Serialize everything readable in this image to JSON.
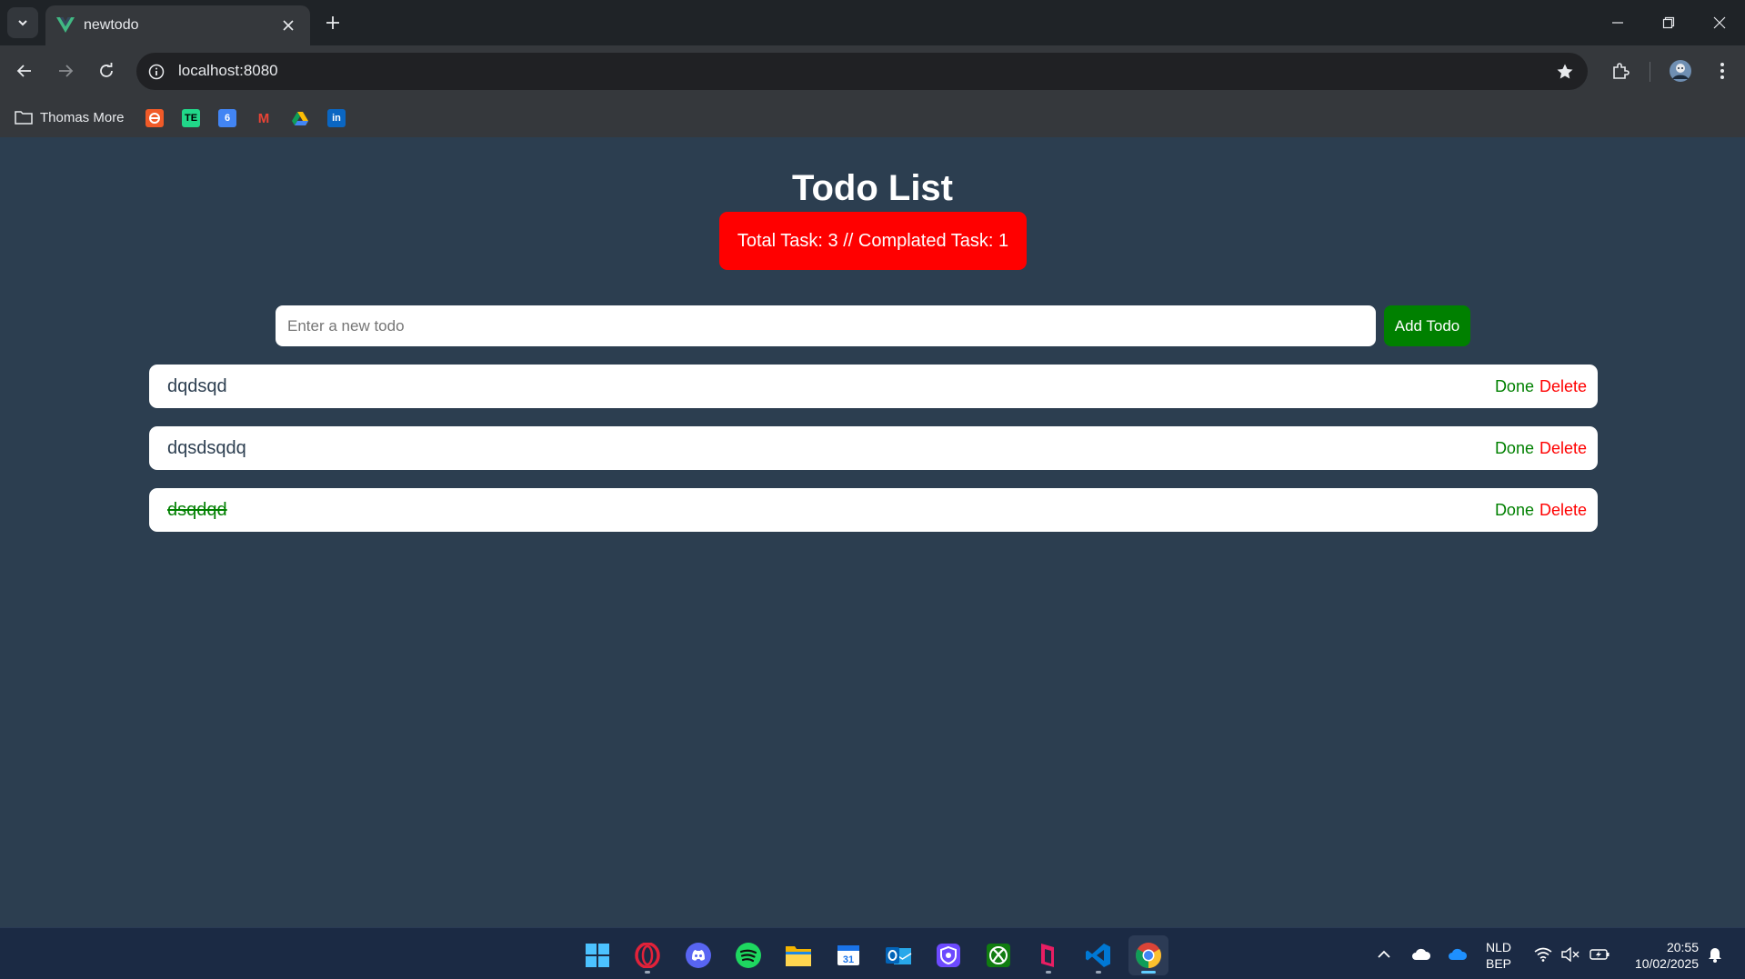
{
  "browser": {
    "tab_title": "newtodo",
    "url": "localhost:8080",
    "bookmarks": {
      "folder_label": "Thomas More",
      "items": [
        "bookmark-1",
        "bookmark-2",
        "bookmark-3",
        "bookmark-4",
        "bookmark-5",
        "bookmark-6"
      ],
      "favicon_texts": [
        "",
        "TE",
        "6",
        "M",
        "",
        "in"
      ]
    }
  },
  "app": {
    "title": "Todo List",
    "stats_text": "Total Task: 3 // Complated Task: 1",
    "input_placeholder": "Enter a new todo",
    "input_value": "",
    "add_button_label": "Add Todo",
    "done_label": "Done",
    "delete_label": "Delete",
    "todos": [
      {
        "text": "dqdsqd",
        "completed": false
      },
      {
        "text": "dqsdsqdq",
        "completed": false
      },
      {
        "text": "dsqdqd",
        "completed": true
      }
    ],
    "colors": {
      "background": "#2c3e50",
      "stats_bg": "#ff0000",
      "add_button_bg": "#008000",
      "done_color": "#008000",
      "delete_color": "#ff0000"
    }
  },
  "taskbar": {
    "apps": [
      "start-icon",
      "opera-icon",
      "discord-icon",
      "spotify-icon",
      "file-explorer-icon",
      "calendar-icon",
      "outlook-icon",
      "proton-vpn-icon",
      "xbox-icon",
      "app-icon",
      "vscode-icon",
      "chrome-icon"
    ],
    "calendar_day": "31",
    "language": "NLD",
    "keyboard": "BEP",
    "time": "20:55",
    "date": "10/02/2025"
  }
}
